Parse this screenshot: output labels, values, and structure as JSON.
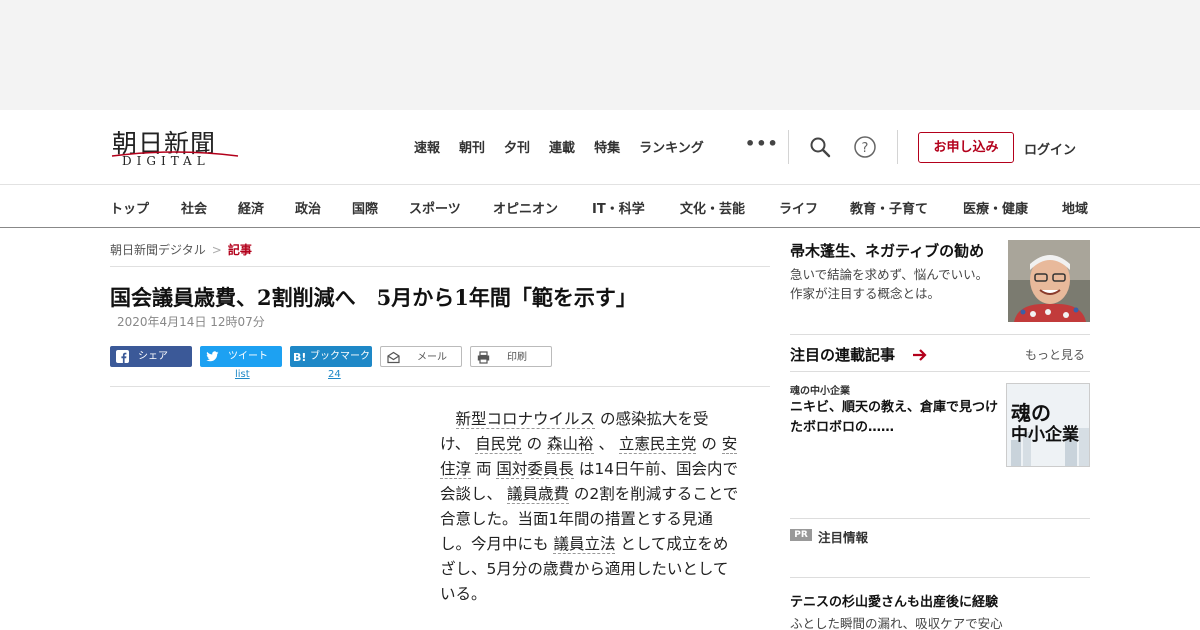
{
  "logo": {
    "kanji": "朝日新聞",
    "latin": "DIGITAL"
  },
  "global_nav": [
    "速報",
    "朝刊",
    "夕刊",
    "連載",
    "特集",
    "ランキング"
  ],
  "more_label": "•••",
  "subscribe_label": "お申し込み",
  "login_label": "ログイン",
  "categories": [
    "トップ",
    "社会",
    "経済",
    "政治",
    "国際",
    "スポーツ",
    "オピニオン",
    "IT・科学",
    "文化・芸能",
    "ライフ",
    "教育・子育て",
    "医療・健康",
    "地域"
  ],
  "breadcrumb": {
    "home": "朝日新聞デジタル",
    "sep": ">",
    "current": "記事"
  },
  "article": {
    "title": "国会議員歳費、2割削減へ　5月から1年間「範を示す」",
    "date": "2020年4月14日 12時07分",
    "body_lines": [
      [
        {
          "t": "　"
        },
        {
          "t": "新型コロナウイルス",
          "link": true
        },
        {
          "t": " の感染拡大を受"
        }
      ],
      [
        {
          "t": "け、 "
        },
        {
          "t": "自民党",
          "link": true
        },
        {
          "t": " の "
        },
        {
          "t": "森山裕",
          "link": true
        },
        {
          "t": " 、 "
        },
        {
          "t": "立憲民主党",
          "link": true
        },
        {
          "t": " の "
        },
        {
          "t": "安",
          "link": true
        }
      ],
      [
        {
          "t": "住淳",
          "link": true
        },
        {
          "t": " 両 "
        },
        {
          "t": "国対委員長",
          "link": true
        },
        {
          "t": " は14日午前、国会内で"
        }
      ],
      [
        {
          "t": "会談し、 "
        },
        {
          "t": "議員歳費",
          "link": true
        },
        {
          "t": " の2割を削減することで"
        }
      ],
      [
        {
          "t": "合意した。当面1年間の措置とする見通"
        }
      ],
      [
        {
          "t": "し。今月中にも "
        },
        {
          "t": "議員立法",
          "link": true
        },
        {
          "t": " として成立をめ"
        }
      ],
      [
        {
          "t": "ざし、5月分の歳費から適用したいとして"
        }
      ],
      [
        {
          "t": "いる。"
        }
      ]
    ]
  },
  "share": {
    "facebook": "シェア",
    "twitter": "ツイート",
    "hatena": "ブックマーク",
    "mail": "メール",
    "print": "印刷",
    "twitter_count": "list",
    "hatena_count": "24"
  },
  "sidebar": {
    "feature": {
      "title": "帚木蓬生、ネガティブの勧め",
      "desc": "急いで結論を求めず、悩んでいい。作家が注目する概念とは。"
    },
    "series": {
      "heading": "注目の連載記事",
      "more": "もっと見る",
      "kicker": "魂の中小企業",
      "headline": "ニキビ、順天の教え、倉庫で見つけたボロボロの……",
      "thumb_text": [
        "魂の",
        "中小企業"
      ]
    },
    "pr": {
      "badge": "PR",
      "label": "注目情報",
      "headline": "テニスの杉山愛さんも出産後に経験",
      "sub": "ふとした瞬間の漏れ、吸収ケアで安心"
    }
  },
  "colors": {
    "brand_red": "#b3001b",
    "facebook": "#3b5998",
    "twitter": "#1da1f2",
    "hatena": "#1e88c7"
  }
}
